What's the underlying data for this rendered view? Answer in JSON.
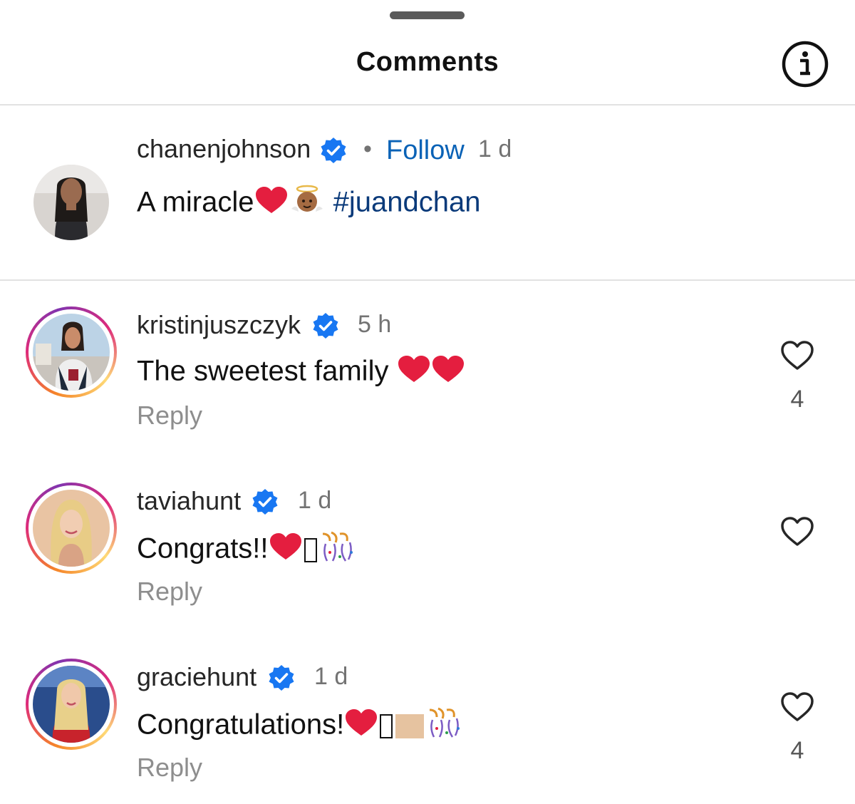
{
  "header": {
    "title": "Comments",
    "info_icon": "info-icon"
  },
  "colors": {
    "link_blue": "#0a62b6",
    "hashtag_blue": "#0a3a7a",
    "verified_blue": "#1877f2",
    "muted": "#737373",
    "heart_red": "#e41e3f"
  },
  "post": {
    "username": "chanenjohnson",
    "verified": true,
    "follow_label": "Follow",
    "separator": "•",
    "time": "1 d",
    "text": "A miracle",
    "hashtag": "#juandchan"
  },
  "comments": [
    {
      "username": "kristinjuszczyk",
      "verified": true,
      "time": "5 h",
      "text": "The sweetest family ",
      "reply_label": "Reply",
      "likes": "4"
    },
    {
      "username": "taviahunt",
      "verified": true,
      "time": "1 d",
      "text": "Congrats!!",
      "reply_label": "Reply",
      "likes": ""
    },
    {
      "username": "graciehunt",
      "verified": true,
      "time": "1 d",
      "text": "Congratulations!",
      "reply_label": "Reply",
      "likes": "4"
    }
  ]
}
